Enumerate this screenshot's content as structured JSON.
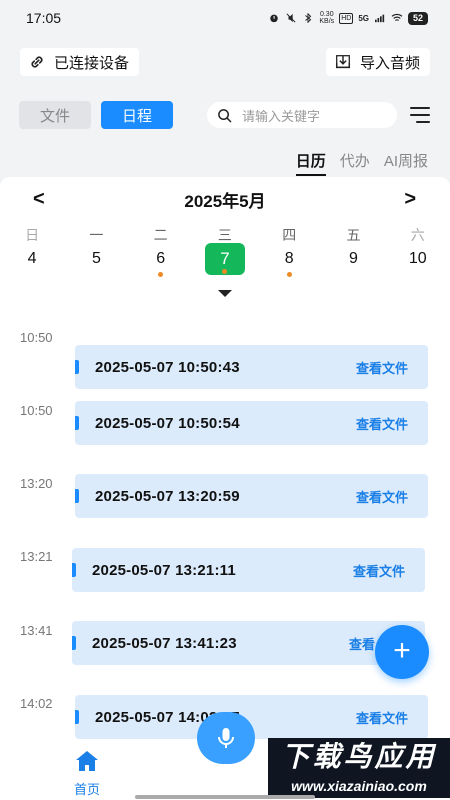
{
  "status_bar": {
    "time": "17:05",
    "net_speed_value": "0.30",
    "net_speed_unit": "KB/s",
    "hd": "HD",
    "signal": "5G",
    "battery": "52"
  },
  "top": {
    "connected_label": "已连接设备",
    "import_label": "导入音频"
  },
  "segments": {
    "file_label": "文件",
    "schedule_label": "日程"
  },
  "search": {
    "placeholder": "请输入关键字"
  },
  "view_tabs": [
    {
      "label": "日历",
      "active": true
    },
    {
      "label": "代办",
      "active": false
    },
    {
      "label": "AI周报",
      "active": false
    }
  ],
  "calendar": {
    "title": "2025年5月",
    "prev": "<",
    "next": ">",
    "weekdays": [
      "日",
      "一",
      "二",
      "三",
      "四",
      "五",
      "六"
    ],
    "days": [
      {
        "num": "4",
        "dot": false,
        "selected": false
      },
      {
        "num": "5",
        "dot": false,
        "selected": false
      },
      {
        "num": "6",
        "dot": true,
        "selected": false
      },
      {
        "num": "7",
        "dot": true,
        "selected": true
      },
      {
        "num": "8",
        "dot": true,
        "selected": false
      },
      {
        "num": "9",
        "dot": false,
        "selected": false
      },
      {
        "num": "10",
        "dot": false,
        "selected": false
      }
    ]
  },
  "records": [
    {
      "time": "10:50",
      "stamp": "2025-05-07 10:50:43",
      "action": "查看文件"
    },
    {
      "time": "10:50",
      "stamp": "2025-05-07 10:50:54",
      "action": "查看文件"
    },
    {
      "time": "13:20",
      "stamp": "2025-05-07 13:20:59",
      "action": "查看文件"
    },
    {
      "time": "13:21",
      "stamp": "2025-05-07 13:21:11",
      "action": "查看文件"
    },
    {
      "time": "13:41",
      "stamp": "2025-05-07 13:41:23",
      "action": "查看"
    },
    {
      "time": "14:02",
      "stamp": "2025-05-07 14:02:57",
      "action": "查看文件"
    }
  ],
  "fab": "+",
  "bottom_nav": {
    "home_label": "首页"
  },
  "watermark": {
    "big": "下载鸟应用",
    "small": "www.xiazainiao.com"
  },
  "colors": {
    "accent": "#1a8cff",
    "selected_day": "#14b85a",
    "event_dot": "#f08a24",
    "card_bg": "#dcebfb"
  }
}
